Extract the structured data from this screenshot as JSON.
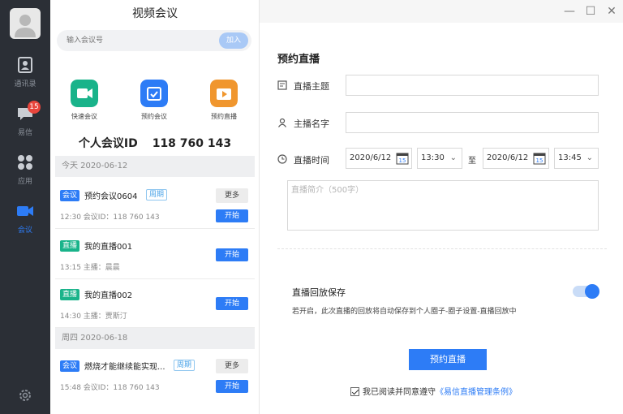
{
  "nav": {
    "items": [
      {
        "label": "通讯录",
        "icon": "contacts-icon"
      },
      {
        "label": "易信",
        "icon": "chat-icon",
        "badge": "15"
      },
      {
        "label": "应用",
        "icon": "apps-icon"
      },
      {
        "label": "会议",
        "icon": "video-icon",
        "active": true
      }
    ],
    "settings_icon": "gear-icon"
  },
  "meeting_panel": {
    "title": "视频会议",
    "search_placeholder": "输入会议号",
    "join_label": "加入",
    "quick_actions": [
      {
        "label": "快速会议",
        "icon": "video-camera-icon",
        "color": "#19b38a"
      },
      {
        "label": "预约会议",
        "icon": "calendar-icon",
        "color": "#2d7cf6"
      },
      {
        "label": "预约直播",
        "icon": "live-play-icon",
        "color": "#f0962e"
      }
    ],
    "personal_id_label": "个人会议ID",
    "personal_id": "118 760 143",
    "days": [
      {
        "date": "今天  2020-06-12",
        "items": [
          {
            "tag": "会议",
            "title": "预约会议0604",
            "cycle": "周期",
            "meta": "12:30  会议ID：118 760 143",
            "more": "更多",
            "start": "开始"
          },
          {
            "tag": "直播",
            "title": "我的直播001",
            "meta": "13:15  主播：晨晨",
            "start": "开始"
          },
          {
            "tag": "直播",
            "title": "我的直播002",
            "meta": "14:30  主播：贾斯汀",
            "start": "开始"
          }
        ]
      },
      {
        "date": "周四  2020-06-18",
        "items": [
          {
            "tag": "会议",
            "title": "燃烧才能继续能实现...",
            "cycle": "周期",
            "meta": "15:48  会议ID：118 760 143",
            "more": "更多",
            "start": "开始"
          }
        ]
      }
    ]
  },
  "form": {
    "heading": "预约直播",
    "topic_label": "直播主题",
    "host_label": "主播名字",
    "time_label": "直播时间",
    "start_date": "2020/6/12",
    "start_time": "13:30",
    "to": "至",
    "end_date": "2020/6/12",
    "end_time": "13:45",
    "calendar_day": "15",
    "intro_placeholder": "直播简介（500字）",
    "replay_label": "直播回放保存",
    "replay_enabled": true,
    "replay_desc": "若开启，此次直播的回放将自动保存到个人圈子-圈子设置-直播回放中",
    "submit_label": "预约直播",
    "agree_text": "我已阅读并同意遵守",
    "agree_link": "《易信直播管理条例》"
  },
  "window": {
    "minimize": "—",
    "maximize": "☐",
    "close": "✕"
  },
  "colors": {
    "nav_bg": "#2b2f36",
    "accent": "#2d7cf6",
    "live": "#19b38a",
    "badge": "#e8453c"
  }
}
